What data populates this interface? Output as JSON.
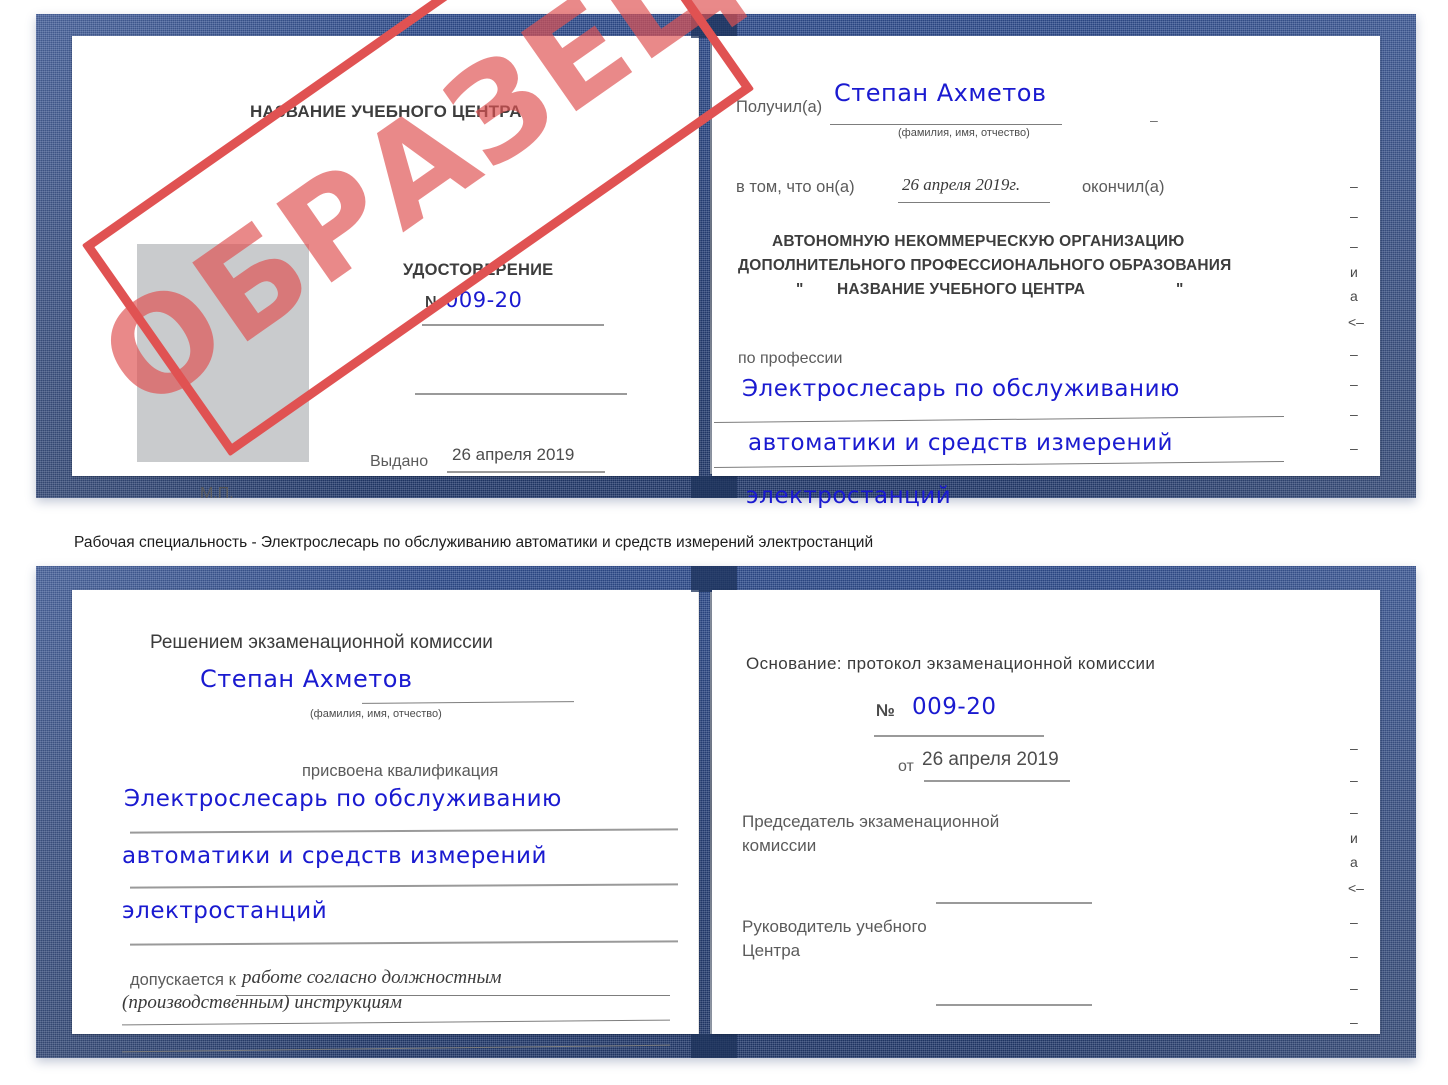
{
  "document": {
    "type": "certificate-scan",
    "caption": "Рабочая специальность - Электрослесарь по обслуживанию автоматики и средств измерений электростанций"
  },
  "stamp": {
    "text": "ОБРАЗЕЦ",
    "color": "#e05252"
  },
  "colors": {
    "cover_blue": "#27417a",
    "handwriting_blue": "#1a1ad0",
    "rule_gray": "#9a9a9a",
    "photo_gray": "#c9cbcd",
    "stamp_red": "#e05252"
  },
  "certificate_top": {
    "left_page": {
      "header": "НАЗВАНИЕ УЧЕБНОГО ЦЕНТРА",
      "title": "УДОСТОВЕРЕНИЕ",
      "number_label": "№",
      "number_value": "009-20",
      "issued_label": "Выдано",
      "issued_value": "26 апреля 2019",
      "seal_label": "М.П.",
      "photo_placeholder": "photo-placeholder"
    },
    "right_page": {
      "received_label": "Получил(а)",
      "received_value": "Степан Ахметов",
      "fio_hint": "(фамилия, имя, отчество)",
      "that_he_label": "в том, что он(а)",
      "completion_date": "26 апреля 2019г.",
      "finished_label": "окончил(а)",
      "org_line1": "АВТОНОМНУЮ НЕКОММЕРЧЕСКУЮ ОРГАНИЗАЦИЮ",
      "org_line2": "ДОПОЛНИТЕЛЬНОГО ПРОФЕССИОНАЛЬНОГО ОБРАЗОВАНИЯ",
      "org_quote_open": "\"",
      "org_name": "НАЗВАНИЕ УЧЕБНОГО ЦЕНТРА",
      "org_quote_close": "\"",
      "profession_label": "по профессии",
      "profession_line1": "Электрослесарь по обслуживанию",
      "profession_line2": "автоматики и средств измерений",
      "profession_line3": "электростанций",
      "edge_marks": [
        "–",
        "–",
        "–",
        "и",
        "а",
        "<–",
        "–",
        "–",
        "–",
        "–"
      ]
    }
  },
  "certificate_bottom": {
    "left_page": {
      "header": "Решением экзаменационной комиссии",
      "name_value": "Степан Ахметов",
      "fio_hint": "(фамилия, имя, отчество)",
      "qualification_label": "присвоена квалификация",
      "qualification_line1": "Электрослесарь по обслуживанию",
      "qualification_line2": "автоматики и средств измерений",
      "qualification_line3": "электростанций",
      "admitted_label": "допускается к",
      "admitted_line1": "работе согласно должностным",
      "admitted_line2": "(производственным) инструкциям"
    },
    "right_page": {
      "basis_label": "Основание: протокол экзаменационной комиссии",
      "number_label": "№",
      "number_value": "009-20",
      "date_label": "от",
      "date_value": "26 апреля 2019",
      "chairman_line1": "Председатель экзаменационной",
      "chairman_line2": "комиссии",
      "head_line1": "Руководитель учебного",
      "head_line2": "Центра",
      "edge_marks": [
        "–",
        "–",
        "–",
        "и",
        "а",
        "<–",
        "–",
        "–",
        "–",
        "–"
      ]
    }
  }
}
